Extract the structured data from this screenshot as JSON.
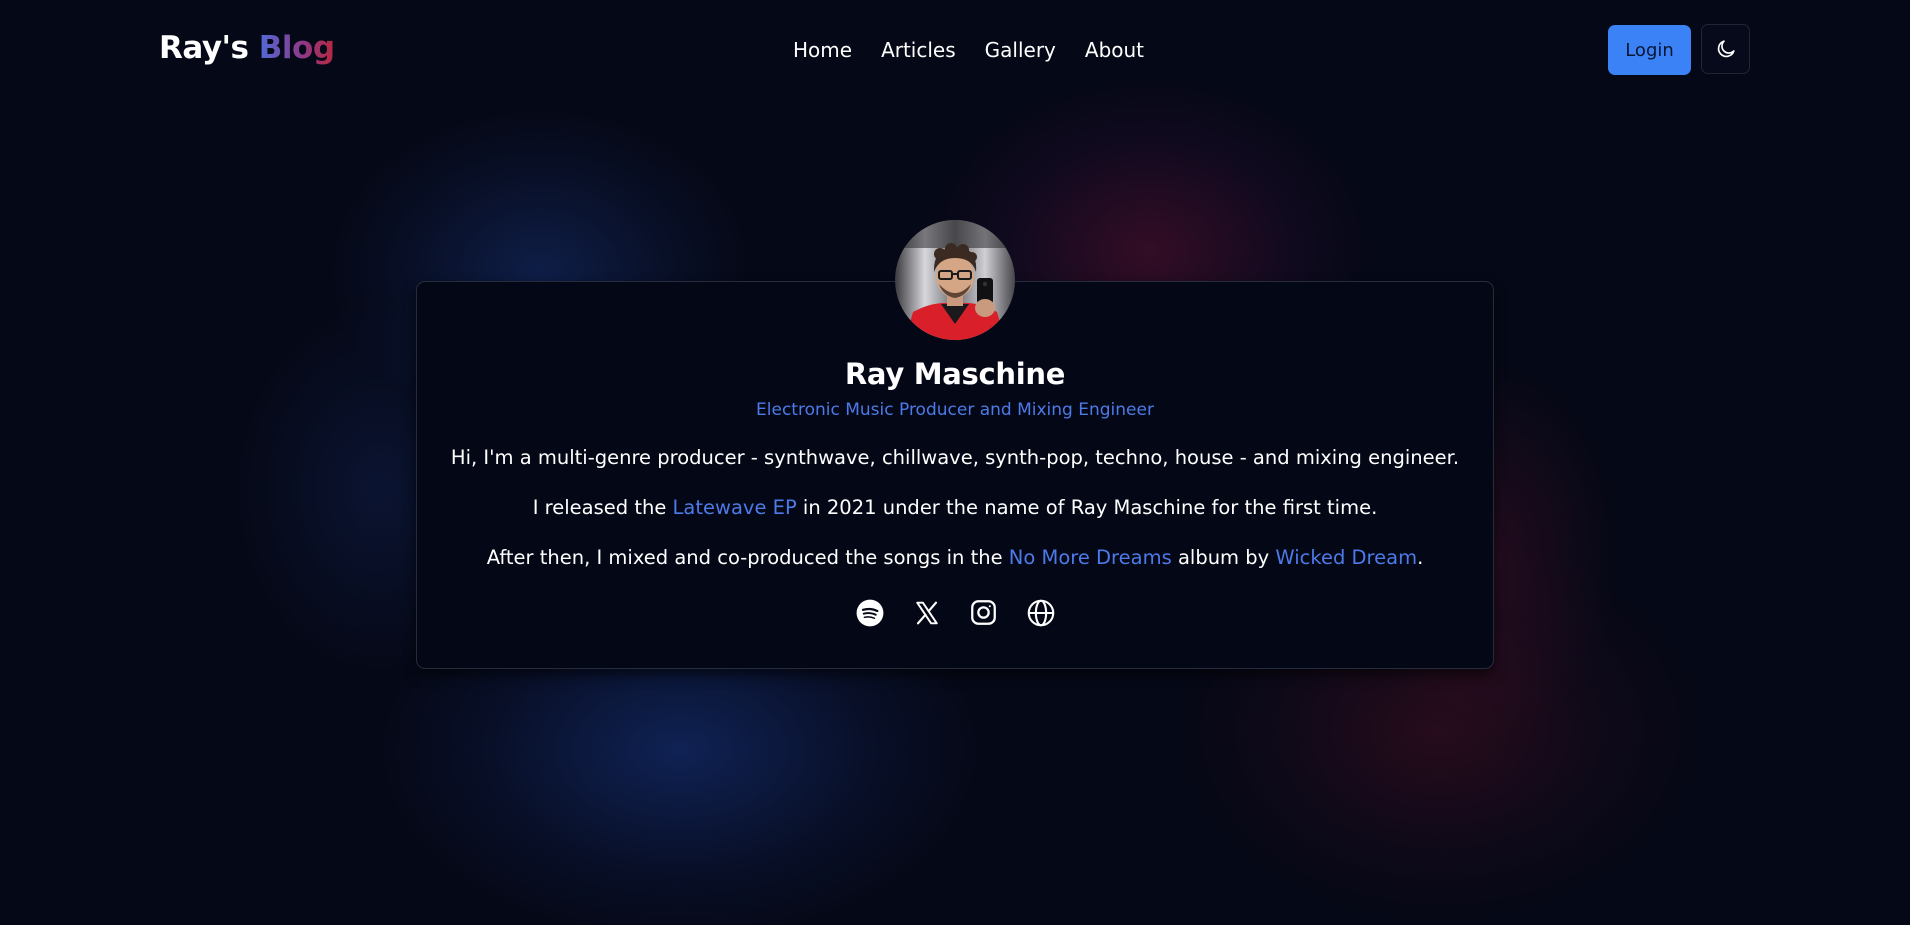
{
  "header": {
    "brand_first": "Ray's",
    "brand_second": "Blog",
    "nav": [
      {
        "label": "Home"
      },
      {
        "label": "Articles"
      },
      {
        "label": "Gallery"
      },
      {
        "label": "About"
      }
    ],
    "login_label": "Login",
    "theme_toggle_icon": "moon-icon"
  },
  "profile": {
    "avatar_icon": "avatar",
    "name": "Ray Maschine",
    "subtitle": "Electronic Music Producer and Mixing Engineer",
    "paragraph1": "Hi, I'm a multi-genre producer - synthwave, chillwave, synth-pop, techno, house - and mixing engineer.",
    "paragraph2": {
      "before": "I released the ",
      "link": "Latewave EP",
      "after": " in 2021 under the name of Ray Maschine for the first time."
    },
    "paragraph3": {
      "before": "After then, I mixed and co-produced the songs in the ",
      "link1": "No More Dreams",
      "middle": " album by ",
      "link2": "Wicked Dream",
      "after": "."
    },
    "socials": [
      "spotify-icon",
      "x-icon",
      "instagram-icon",
      "globe-icon"
    ]
  },
  "colors": {
    "background": "#050816",
    "accent": "#3b82f6",
    "link": "#4d7ae8",
    "brand_gradient_start": "#4f6bd8",
    "brand_gradient_end": "#b8283f"
  }
}
